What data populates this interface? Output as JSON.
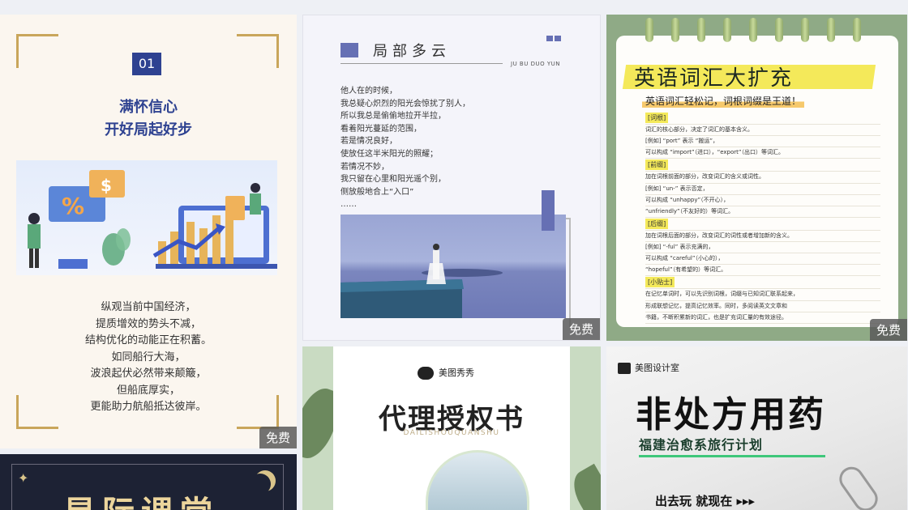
{
  "badges": {
    "free": "免费"
  },
  "card1": {
    "number": "01",
    "title_line1": "满怀信心",
    "title_line2": "开好局起好步",
    "poem": [
      "纵观当前中国经济，",
      "提质增效的势头不减，",
      "结构优化的动能正在积蓄。",
      "如同船行大海，",
      "波浪起伏必然带来颠簸，",
      "但船底厚实，",
      "更能助力航船抵达彼岸。"
    ],
    "icons": [
      "percent-icon",
      "dollar-icon",
      "calculator-icon"
    ]
  },
  "card2": {
    "title": "局部多云",
    "pinyin": "JU BU DUO YUN",
    "poem": [
      "他人在的时候，",
      "我总疑心炽烈的阳光会惊扰了别人，",
      "所以我总是偷偷地拉开半拉，",
      "看着阳光蔓延的范围，",
      "若是情况良好，",
      "使放任这半米阳光的照耀；",
      "若情况不妙，",
      "我只留在心里和阳光遥个别，",
      "侧放般地合上“入口”",
      "……"
    ]
  },
  "card3": {
    "title": "英语词汇大扩充",
    "subtitle": "英语词汇轻松记，词根词缀是王道！",
    "lines": [
      {
        "h": "[词根]"
      },
      {
        "t": "词汇的核心部分，决定了词汇的基本含义。"
      },
      {
        "t": "[例如] “port” 表示 “搬运”，"
      },
      {
        "t": "可以构成 “import”（进口），“export”（出口）等词汇。"
      },
      {
        "h": "[前缀]"
      },
      {
        "t": "加在词根前面的部分，改变词汇的含义或词性。"
      },
      {
        "t": "[例如] “un-” 表示否定，"
      },
      {
        "t": "可以构成 “unhappy”（不开心），"
      },
      {
        "t": "“unfriendly”（不友好的）等词汇。"
      },
      {
        "h": "[后缀]"
      },
      {
        "t": "加在词根后面的部分，改变词汇的词性或者增加新的含义。"
      },
      {
        "t": "[例如] “-ful” 表示充满的，"
      },
      {
        "t": "可以构成 “careful”（小心的），"
      },
      {
        "t": "“hopeful”（有希望的）等词汇。"
      },
      {
        "h": "[小贴士]"
      },
      {
        "t": "在记忆单词时，可以先识别词根，词缀与已知词汇联系起来，"
      },
      {
        "t": "形成联想记忆，提高记忆效率。同时，多阅读英文文章和"
      },
      {
        "t": "书籍，不断积累新的词汇，也是扩充词汇量的有效途径。"
      }
    ]
  },
  "card4": {
    "brand": "美图秀秀",
    "title": "代理授权书",
    "pinyin": "DAILISHOUQUANSHU"
  },
  "card5": {
    "brand": "美图设计室",
    "title": "非处方用药",
    "subtitle": "福建治愈系旅行计划",
    "cta": "出去玩 就现在 ▸▸▸"
  },
  "card6": {
    "title": "星际课堂"
  }
}
